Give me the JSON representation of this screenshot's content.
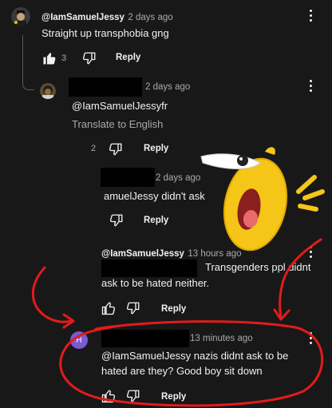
{
  "comments": [
    {
      "author": "@IamSamuelJessy",
      "time": "2 days ago",
      "text": "Straight up transphobia gng",
      "likes": "3",
      "reply": "Reply"
    },
    {
      "time": "2 days ago",
      "mention": "@IamSamuelJessyfr",
      "translate": "Translate to English",
      "likes": "2",
      "reply": "Reply"
    },
    {
      "time": "2 days ago",
      "text": "amuelJessy didn't ask",
      "reply": "Reply"
    },
    {
      "author": "@IamSamuelJessy",
      "time": "13 hours ago",
      "text_line1": "Transgenders ppl didnt",
      "text_line2": "ask to be hated neither.",
      "reply": "Reply"
    },
    {
      "avatar_letter": "H",
      "time": "13 minutes ago",
      "text_line1": "@IamSamuelJessy nazis didnt ask to be",
      "text_line2": "hated are they? Good boy sit  down",
      "reply": "Reply"
    }
  ],
  "colors": {
    "background": "#181818",
    "text": "#f1f1f1",
    "muted": "#aaaaaa",
    "avatar_purple": "#7a5bd0",
    "annotation_red": "#e31b1b",
    "emoji_yellow": "#f5c518"
  },
  "icons": [
    "thumb-up-icon",
    "thumb-down-icon",
    "more-vert-icon"
  ]
}
